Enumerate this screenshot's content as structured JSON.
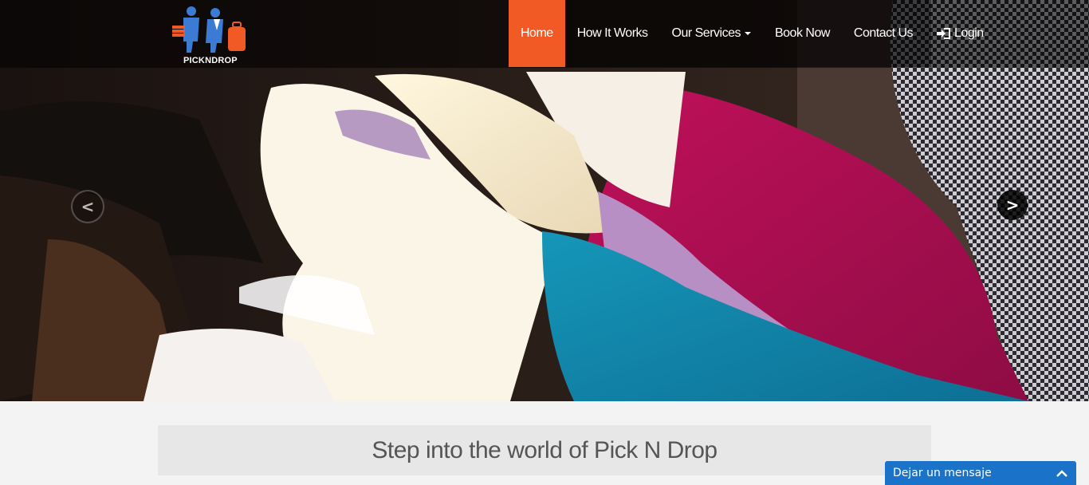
{
  "brand": {
    "logo_text": "PICKNDROP",
    "accent": "#f15a24",
    "logo_color": "#3b7bd4"
  },
  "nav": {
    "items": [
      {
        "label": "Home",
        "active": true
      },
      {
        "label": "How It Works"
      },
      {
        "label": "Our Services",
        "dropdown": true
      },
      {
        "label": "Book Now"
      },
      {
        "label": "Contact Us"
      }
    ],
    "login_label": "Login",
    "login_icon": "sign-in-icon"
  },
  "carousel": {
    "prev_label": "<",
    "next_label": ">"
  },
  "content": {
    "tagline": "Step into the world of Pick N Drop"
  },
  "chat": {
    "label": "Dejar un mensaje",
    "icon": "chevron-up-icon",
    "color": "#1a73c8"
  }
}
